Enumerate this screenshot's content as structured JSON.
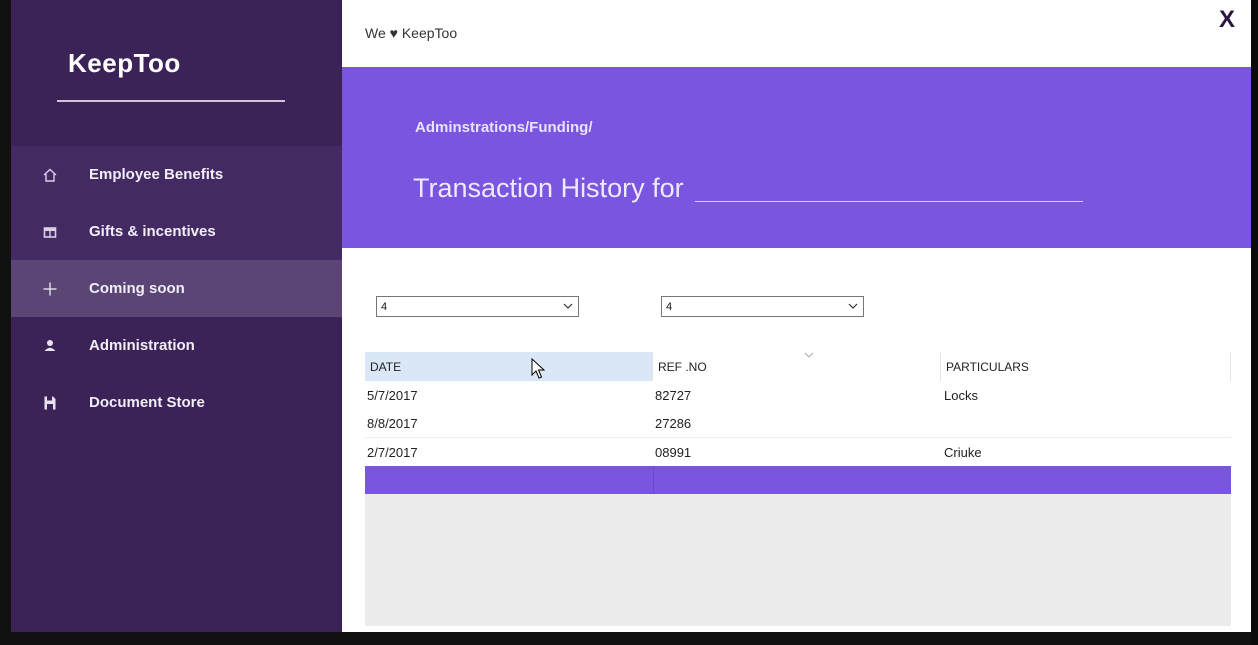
{
  "sidebar": {
    "brand": "KeepToo",
    "items": [
      {
        "label": "Employee Benefits",
        "icon": "home-icon"
      },
      {
        "label": "Gifts & incentives",
        "icon": "gift-icon"
      },
      {
        "label": "Coming soon",
        "icon": "plus-icon"
      },
      {
        "label": "Administration",
        "icon": "person-icon"
      },
      {
        "label": "Document Store",
        "icon": "save-icon"
      }
    ],
    "active_index": 2
  },
  "header": {
    "tagline": "We ♥ KeepToo",
    "close_label": "X"
  },
  "banner": {
    "breadcrumb": "Adminstrations/Funding/",
    "title": "Transaction History for"
  },
  "filters": {
    "combo1_value": "4",
    "combo2_value": "4"
  },
  "grid": {
    "columns": [
      "DATE",
      "REF .NO",
      "PARTICULARS"
    ],
    "rows": [
      [
        "5/7/2017",
        "82727",
        "Locks"
      ],
      [
        "8/8/2017",
        "27286",
        ""
      ],
      [
        "2/7/2017",
        "08991",
        "Criuke"
      ]
    ]
  },
  "colors": {
    "sidebar": "#3b2358",
    "accent": "#7a55e0"
  }
}
